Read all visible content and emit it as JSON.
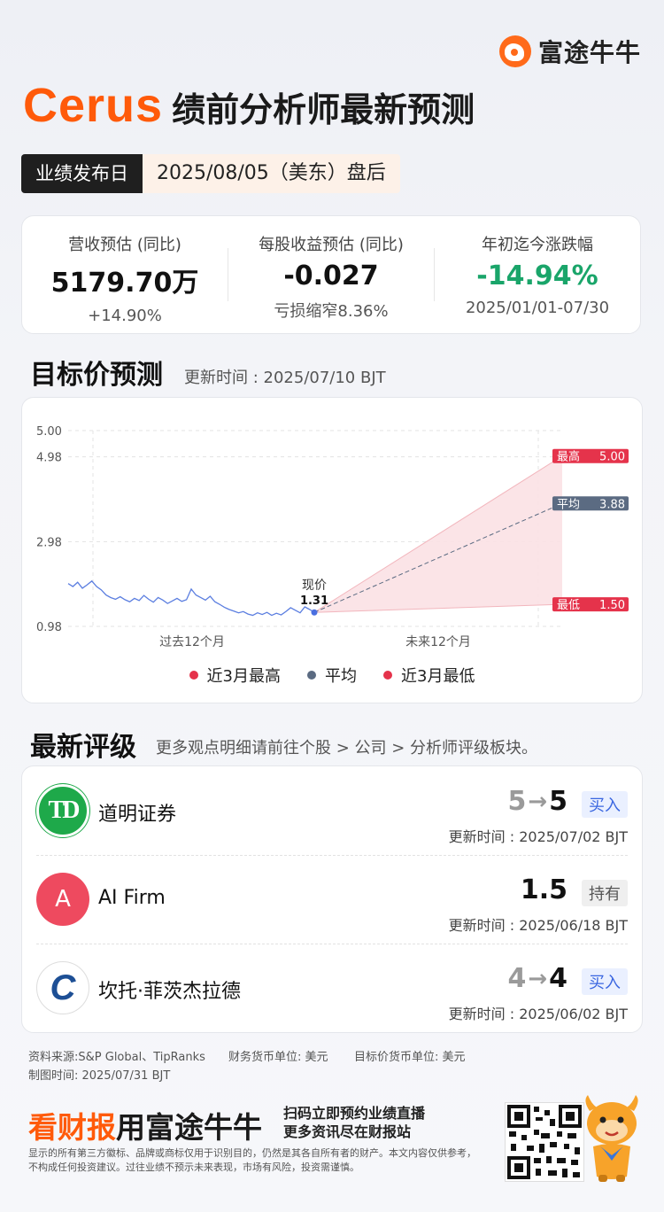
{
  "brand": {
    "name": "富途牛牛"
  },
  "header": {
    "company": "Cerus",
    "title": "绩前分析师最新预测",
    "release_label": "业绩发布日",
    "release_value": "2025/08/05（美东）盘后"
  },
  "stats": [
    {
      "label": "营收预估 (同比)",
      "value": "5179.70万",
      "sub": "+14.90%"
    },
    {
      "label": "每股收益预估 (同比)",
      "value": "-0.027",
      "sub": "亏损缩窄8.36%"
    },
    {
      "label": "年初迄今涨跌幅",
      "value": "-14.94%",
      "sub": "2025/01/01-07/30"
    }
  ],
  "target_section": {
    "title": "目标价预测",
    "updated": "更新时间 : 2025/07/10 BJT"
  },
  "chart_data": {
    "type": "line",
    "y_ticks": [
      "5.00",
      "4.98",
      "2.98",
      "0.98"
    ],
    "x_labels": [
      "过去12个月",
      "未来12个月"
    ],
    "current_label": "现价",
    "current_price": "1.31",
    "targets": [
      {
        "name": "最高",
        "value": "5.00",
        "color": "#e5334b"
      },
      {
        "name": "平均",
        "value": "3.88",
        "color": "#5b6b82"
      },
      {
        "name": "最低",
        "value": "1.50",
        "color": "#e5334b"
      }
    ],
    "ylim": [
      0.98,
      5.6
    ],
    "history": [
      1.99,
      1.92,
      2.02,
      1.88,
      1.96,
      2.05,
      1.92,
      1.84,
      1.72,
      1.66,
      1.62,
      1.68,
      1.61,
      1.56,
      1.64,
      1.59,
      1.71,
      1.62,
      1.55,
      1.66,
      1.6,
      1.52,
      1.58,
      1.64,
      1.57,
      1.61,
      1.86,
      1.72,
      1.66,
      1.6,
      1.69,
      1.56,
      1.5,
      1.43,
      1.38,
      1.34,
      1.3,
      1.33,
      1.27,
      1.24,
      1.3,
      1.26,
      1.31,
      1.24,
      1.29,
      1.25,
      1.33,
      1.42,
      1.36,
      1.3,
      1.44,
      1.38,
      1.31
    ],
    "legend": [
      {
        "name": "近3月最高",
        "color": "#e5334b"
      },
      {
        "name": "平均",
        "color": "#5b6b82"
      },
      {
        "name": "近3月最低",
        "color": "#e5334b"
      }
    ]
  },
  "ratings_section": {
    "title": "最新评级",
    "subtitle": "更多观点明细请前往个股 > 公司 > 分析师评级板块。"
  },
  "ratings": [
    {
      "firm": "道明证券",
      "old": "5",
      "arrow": "→",
      "new": "5",
      "rating": "买入",
      "updated": "更新时间 : 2025/07/02 BJT",
      "logo_text": "TD"
    },
    {
      "firm": "AI Firm",
      "old": "",
      "arrow": "",
      "new": "1.5",
      "rating": "持有",
      "updated": "更新时间 : 2025/06/18 BJT",
      "logo_text": "A"
    },
    {
      "firm": "坎托·菲茨杰拉德",
      "old": "4",
      "arrow": "→",
      "new": "4",
      "rating": "买入",
      "updated": "更新时间 : 2025/06/02 BJT",
      "logo_text": "C"
    }
  ],
  "footnotes": {
    "source": "资料来源:S&P Global、TipRanks",
    "fin_currency": "财务货币单位: 美元",
    "target_currency": "目标价货币单位: 美元",
    "made_time": "制图时间: 2025/07/31 BJT"
  },
  "footer": {
    "slogan_a": "看财报",
    "slogan_b": "用富途牛牛",
    "cta_1": "扫码立即预约业绩直播",
    "cta_2": "更多资讯尽在财报站",
    "disclaimer": "显示的所有第三方徽标、品牌或商标仅用于识别目的，仍然是其各自所有者的财产。本文内容仅供参考，不构成任何投资建议。过往业绩不预示未来表现，市场有风险，投资需谨慎。"
  },
  "colors": {
    "accent": "#ff5a0a",
    "green": "#1aa56a",
    "red": "#e5334b",
    "slate": "#5b6b82"
  }
}
